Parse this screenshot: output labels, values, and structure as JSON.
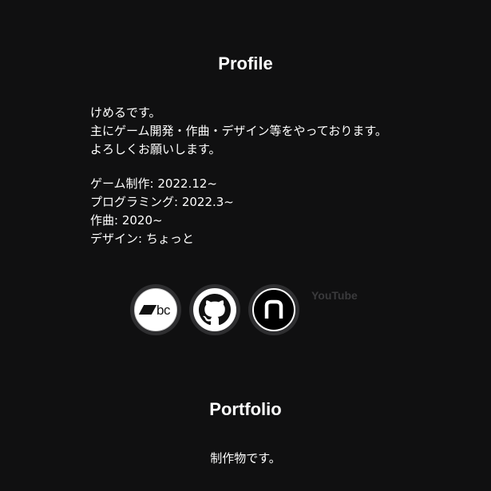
{
  "profile": {
    "title": "Profile",
    "intro_lines": [
      "けめるです。",
      "主にゲーム開発・作曲・デザイン等をやっております。",
      "よろしくお願いします。"
    ],
    "history_lines": [
      "ゲーム制作: 2022.12~",
      "プログラミング: 2022.3~",
      "作曲: 2020~",
      "デザイン: ちょっと"
    ]
  },
  "social": {
    "bandcamp_text": "bc",
    "links": [
      {
        "name": "bandcamp",
        "icon": "bandcamp-icon"
      },
      {
        "name": "github",
        "icon": "github-icon"
      },
      {
        "name": "note",
        "icon": "note-icon"
      }
    ],
    "youtube_label": "YouTube"
  },
  "portfolio": {
    "title": "Portfolio",
    "description": "制作物です。"
  },
  "colors": {
    "background": "#101011",
    "text": "#ffffff",
    "icon_ring": "#2e2e30",
    "youtube_text": "#3a3a3c"
  }
}
